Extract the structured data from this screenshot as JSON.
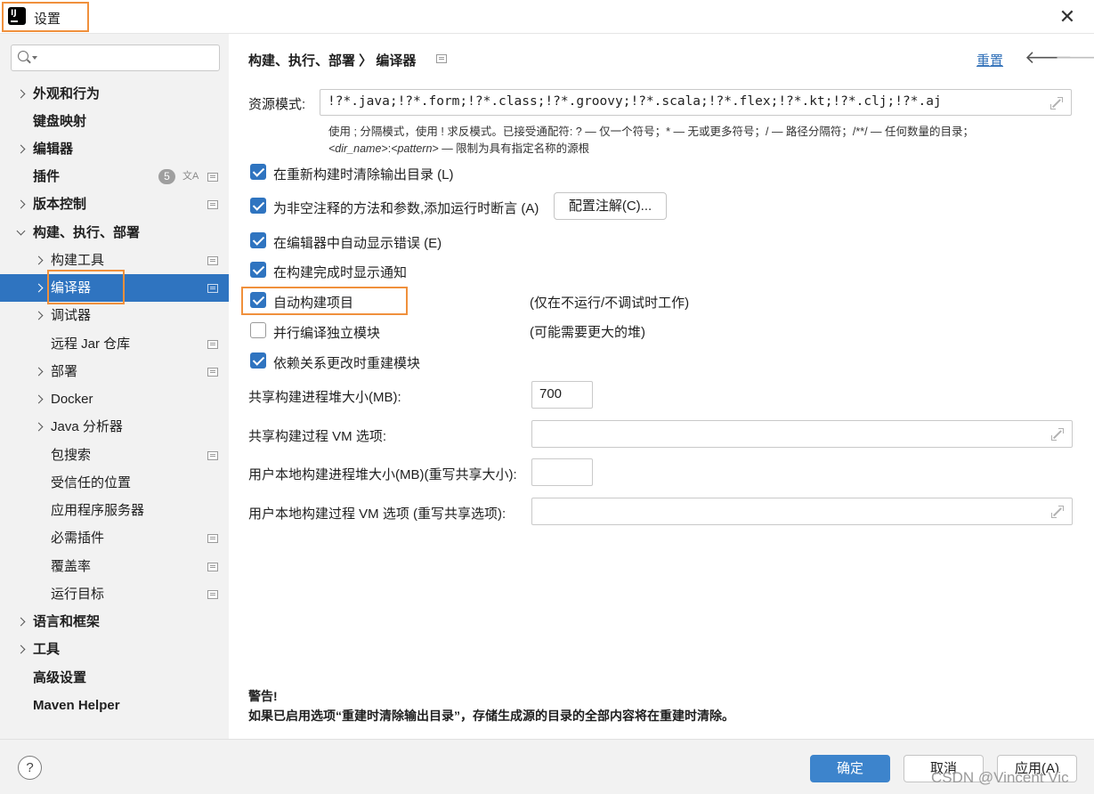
{
  "window": {
    "title": "设置",
    "close_glyph": "✕",
    "app_icon": "intellij-idea-icon",
    "app_icon_text": "IJ"
  },
  "search": {
    "value": "",
    "placeholder": ""
  },
  "sidebar": {
    "items": [
      {
        "label": "外观和行为",
        "expandable": true,
        "expanded": false,
        "bold": true
      },
      {
        "label": "键盘映射",
        "bold": true
      },
      {
        "label": "编辑器",
        "expandable": true,
        "expanded": false,
        "bold": true
      },
      {
        "label": "插件",
        "bold": true,
        "badge": "5",
        "extra_icon": "translate-icon",
        "project_icon": true
      },
      {
        "label": "版本控制",
        "expandable": true,
        "expanded": false,
        "bold": true,
        "project_icon": true
      },
      {
        "label": "构建、执行、部署",
        "expandable": true,
        "expanded": true,
        "bold": true
      },
      {
        "label": "构建工具",
        "expandable": true,
        "expanded": false,
        "project_icon": true
      },
      {
        "label": "编译器",
        "expandable": true,
        "expanded": false,
        "selected": true,
        "project_icon": true
      },
      {
        "label": "调试器",
        "expandable": true,
        "expanded": false
      },
      {
        "label": "远程 Jar 仓库",
        "project_icon": true
      },
      {
        "label": "部署",
        "expandable": true,
        "expanded": false,
        "project_icon": true
      },
      {
        "label": "Docker",
        "expandable": true,
        "expanded": false
      },
      {
        "label": "Java 分析器",
        "expandable": true,
        "expanded": false
      },
      {
        "label": "包搜索",
        "project_icon": true
      },
      {
        "label": "受信任的位置"
      },
      {
        "label": "应用程序服务器"
      },
      {
        "label": "必需插件",
        "project_icon": true
      },
      {
        "label": "覆盖率",
        "project_icon": true
      },
      {
        "label": "运行目标",
        "project_icon": true
      },
      {
        "label": "语言和框架",
        "expandable": true,
        "expanded": false,
        "bold": true
      },
      {
        "label": "工具",
        "expandable": true,
        "expanded": false,
        "bold": true
      },
      {
        "label": "高级设置",
        "bold": true
      },
      {
        "label": "Maven Helper",
        "bold": true
      }
    ]
  },
  "header": {
    "breadcrumb": "构建、执行、部署  〉 编译器",
    "reset_label": "重置",
    "back_glyph": "🡐",
    "forward_glyph": "🡒"
  },
  "resource": {
    "label": "资源模式:",
    "value": "!?*.java;!?*.form;!?*.class;!?*.groovy;!?*.scala;!?*.flex;!?*.kt;!?*.clj;!?*.aj",
    "hint_line1": "使用 ; 分隔模式，使用 ! 求反模式。已接受通配符: ? — 仅一个符号；* — 无或更多符号；/ — 路径分隔符；/**/ — 任何数量的目录；",
    "hint_line2_a": "<dir_name>",
    "hint_line2_b": ":",
    "hint_line2_c": "<pattern>",
    "hint_line2_d": " — 限制为具有指定名称的源根"
  },
  "options": {
    "clear_output": {
      "label": "在重新构建时清除输出目录 (L)",
      "checked": true
    },
    "runtime_assert": {
      "label": "为非空注释的方法和参数,添加运行时断言 (A)",
      "checked": true
    },
    "configure_annotations_label": "配置注解(C)...",
    "show_errors": {
      "label": "在编辑器中自动显示错误 (E)",
      "checked": true
    },
    "notify_done": {
      "label": "在构建完成时显示通知",
      "checked": true
    },
    "auto_build": {
      "label": "自动构建项目",
      "checked": true,
      "note": "(仅在不运行/不调试时工作)"
    },
    "parallel": {
      "label": "并行编译独立模块",
      "checked": false,
      "note": "(可能需要更大的堆)"
    },
    "rebuild_deps": {
      "label": "依赖关系更改时重建模块",
      "checked": true
    }
  },
  "fields": {
    "shared_heap": {
      "label": "共享构建进程堆大小(MB):",
      "value": "700"
    },
    "shared_vm": {
      "label": "共享构建过程 VM 选项:",
      "value": ""
    },
    "local_heap": {
      "label": "用户本地构建进程堆大小(MB)(重写共享大小):",
      "value": ""
    },
    "local_vm": {
      "label": "用户本地构建过程 VM 选项 (重写共享选项):",
      "value": ""
    }
  },
  "warning": {
    "title": "警告!",
    "body": "如果已启用选项“重建时清除输出目录”，存储生成源的目录的全部内容将在重建时清除。"
  },
  "footer": {
    "help_label": "?",
    "ok_label": "确定",
    "cancel_label": "取消",
    "apply_label": "应用(A)"
  },
  "watermark": "CSDN @Vincent Vic",
  "colors": {
    "accent": "#2f74c0",
    "highlight_box": "#f0903c",
    "link": "#2f6fb8"
  }
}
